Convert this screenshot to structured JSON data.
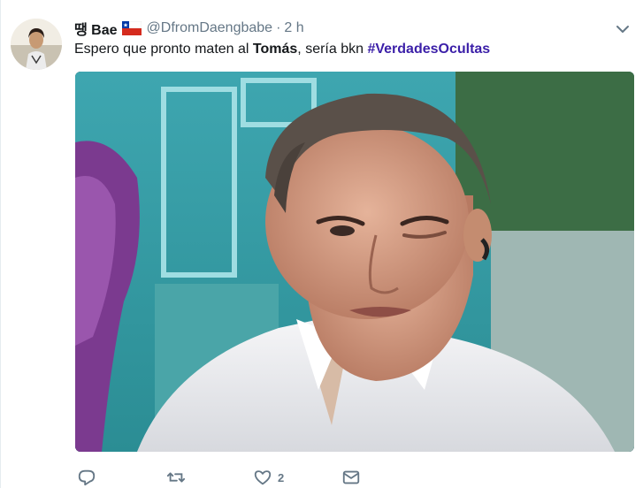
{
  "tweet": {
    "author_name": "땡 Bae",
    "handle": "@DfromDaengbabe",
    "separator": "·",
    "time": "2 h",
    "text": {
      "part1": "Espero que pronto maten al ",
      "bold": "Tomás",
      "part2": ", sería bkn ",
      "hashtag": "#VerdadesOcultas"
    },
    "like_count": "2"
  },
  "colors": {
    "hashtag": "#3b1fa8",
    "text": "#14171a",
    "muted": "#657786"
  },
  "icons": {
    "caret": "chevron-down-icon",
    "reply": "reply-icon",
    "retweet": "retweet-icon",
    "like": "heart-icon",
    "dm": "envelope-icon",
    "flag": "chile-flag-icon"
  }
}
